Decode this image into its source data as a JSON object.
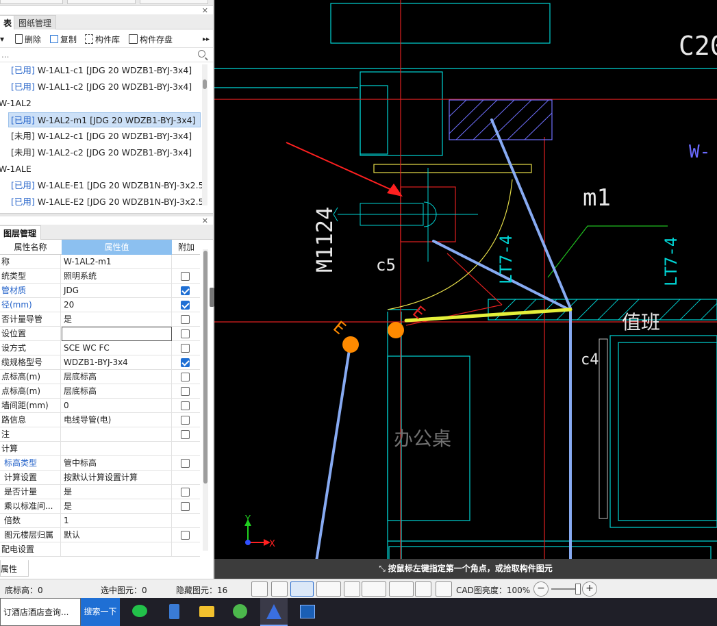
{
  "component_panel": {
    "tabs": [
      "表",
      "图纸管理"
    ],
    "toolbar": {
      "delete_label": "删除",
      "copy_label": "复制",
      "library_label": "构件库",
      "save_label": "构件存盘"
    },
    "search_placeholder": "...",
    "tree": [
      {
        "tag": "[已用]",
        "label": "W-1AL1-c1 [JDG 20 WDZB1-BYJ-3x4]",
        "indent": 2,
        "used": true
      },
      {
        "tag": "[已用]",
        "label": "W-1AL1-c2 [JDG 20 WDZB1-BYJ-3x4]",
        "indent": 2,
        "used": true
      },
      {
        "tag": "",
        "label": "W-1AL2",
        "indent": 0,
        "used": false
      },
      {
        "tag": "[已用]",
        "label": "W-1AL2-m1 [JDG 20 WDZB1-BYJ-3x4]",
        "indent": 2,
        "used": true,
        "selected": true
      },
      {
        "tag": "[未用]",
        "label": "W-1AL2-c1 [JDG 20 WDZB1-BYJ-3x4]",
        "indent": 2,
        "used": false
      },
      {
        "tag": "[未用]",
        "label": "W-1AL2-c2 [JDG 20 WDZB1-BYJ-3x4]",
        "indent": 2,
        "used": false
      },
      {
        "tag": "",
        "label": "W-1ALE",
        "indent": 0,
        "used": false
      },
      {
        "tag": "[已用]",
        "label": "W-1ALE-E1 [JDG 20 WDZB1N-BYJ-3x2.5]",
        "indent": 2,
        "used": true
      },
      {
        "tag": "[已用]",
        "label": "W-1ALE-E2 [JDG 20 WDZB1N-BYJ-3x2.5]",
        "indent": 2,
        "used": true
      }
    ]
  },
  "property_panel": {
    "tab": "图层管理",
    "headers": {
      "name": "属性名称",
      "value": "属性值",
      "extra": "附加"
    },
    "rows": [
      {
        "name": "称",
        "value": "W-1AL2-m1",
        "check": null,
        "blue": false
      },
      {
        "name": "统类型",
        "value": "照明系统",
        "check": false,
        "blue": false
      },
      {
        "name": "管材质",
        "value": "JDG",
        "check": true,
        "blue": true
      },
      {
        "name": "径(mm)",
        "value": "20",
        "check": true,
        "blue": true
      },
      {
        "name": "否计量导管",
        "value": "是",
        "check": false,
        "blue": false
      },
      {
        "name": "设位置",
        "value": "",
        "check": false,
        "blue": false,
        "editing": true
      },
      {
        "name": "设方式",
        "value": "SCE WC FC",
        "check": false,
        "blue": false
      },
      {
        "name": "缆规格型号",
        "value": "WDZB1-BYJ-3x4",
        "check": true,
        "blue": false
      },
      {
        "name": "点标高(m)",
        "value": "层底标高",
        "check": false,
        "blue": false
      },
      {
        "name": "点标高(m)",
        "value": "层底标高",
        "check": false,
        "blue": false
      },
      {
        "name": "墙间距(mm)",
        "value": "0",
        "check": false,
        "blue": false
      },
      {
        "name": "路信息",
        "value": "电线导管(电)",
        "check": false,
        "blue": false
      },
      {
        "name": "注",
        "value": "",
        "check": false,
        "blue": false
      },
      {
        "name": "计算",
        "value": "",
        "check": null,
        "blue": false
      },
      {
        "name": "标高类型",
        "value": "管中标高",
        "check": false,
        "blue": true,
        "sub": true
      },
      {
        "name": "计算设置",
        "value": "按默认计算设置计算",
        "check": null,
        "blue": false,
        "sub": true
      },
      {
        "name": "是否计量",
        "value": "是",
        "check": false,
        "blue": false,
        "sub": true
      },
      {
        "name": "乘以标准间...",
        "value": "是",
        "check": false,
        "blue": false,
        "sub": true
      },
      {
        "name": "倍数",
        "value": "1",
        "check": null,
        "blue": false,
        "sub": true
      },
      {
        "name": "图元楼层归属",
        "value": "默认",
        "check": false,
        "blue": false,
        "sub": true
      },
      {
        "name": "配电设置",
        "value": "",
        "check": null,
        "blue": false
      }
    ],
    "bottom_tab": "属性"
  },
  "canvas": {
    "hint": "按鼠标左键指定第一个角点，或拾取构件图元",
    "labels": {
      "c20": "C20",
      "w_label": "W-",
      "m1": "m1",
      "m1124": "M1124",
      "c5": "c5",
      "lt_a": "LT7-4",
      "lt_b": "LT7-4",
      "duty": "值班",
      "c4": "c4",
      "desk": "办公桌",
      "e1": "E",
      "e2": "E",
      "axis_x": "X",
      "axis_y": "Y"
    }
  },
  "statusbar": {
    "floor_elev": "底标高：0",
    "selected": "选中图元：0",
    "hidden": "隐藏图元：16",
    "cad_brightness": "CAD图亮度：100%"
  },
  "taskbar": {
    "search_text": "订酒店酒店查询...",
    "search_button": "搜索一下",
    "apps": [
      "wechat-icon",
      "calculator-icon",
      "file-explorer-icon",
      "browser-icon",
      "glodon-icon",
      "cad-icon"
    ]
  },
  "colors": {
    "selection": "#cce0f7",
    "accent_blue": "#1f5fc8",
    "orange_grip": "#ff8a00",
    "highlight_yellow": "#e5f03a",
    "cad_cyan": "#00d5d5",
    "cad_red": "#e02020",
    "cad_yellow": "#e8e04a"
  }
}
